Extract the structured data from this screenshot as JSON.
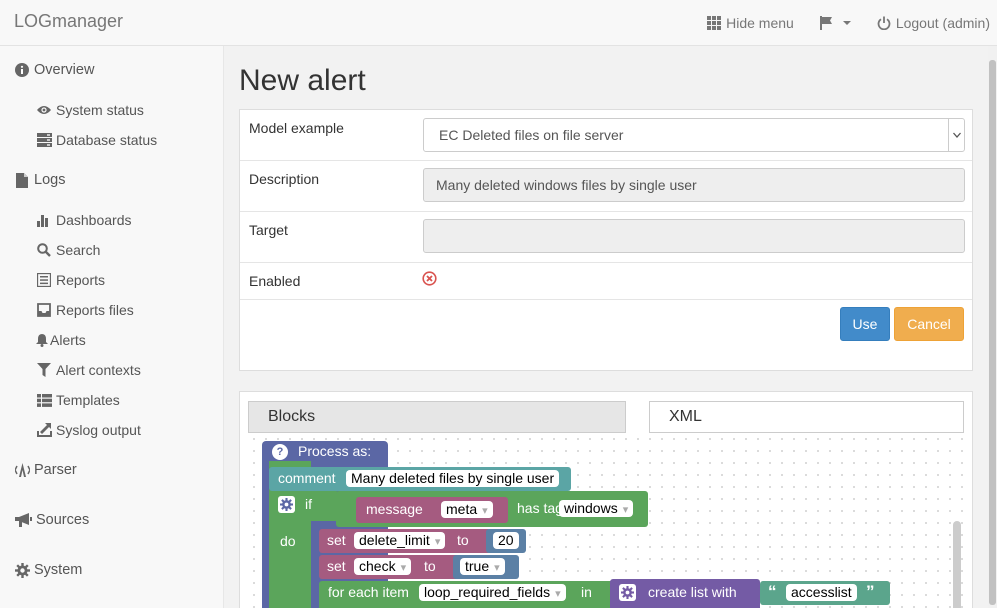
{
  "app": {
    "brand": "LOGmanager"
  },
  "navbar": {
    "hide_menu": "Hide menu",
    "logout": "Logout (admin)",
    "icons": [
      "grid-icon",
      "flag-icon",
      "power-icon"
    ]
  },
  "sidebar": {
    "overview": "Overview",
    "system_status": "System status",
    "database_status": "Database status",
    "logs": "Logs",
    "dashboards": "Dashboards",
    "search": "Search",
    "reports": "Reports",
    "reports_files": "Reports files",
    "alerts": "Alerts",
    "alert_contexts": "Alert contexts",
    "templates": "Templates",
    "syslog_output": "Syslog output",
    "parser": "Parser",
    "sources": "Sources",
    "system": "System"
  },
  "page": {
    "title": "New alert"
  },
  "form": {
    "model_label": "Model example",
    "model_value": "EC Deleted files on file server",
    "description_label": "Description",
    "description_value": "Many deleted windows files by single user",
    "target_label": "Target",
    "target_value": "",
    "enabled_label": "Enabled",
    "enabled": false,
    "use_button": "Use",
    "cancel_button": "Cancel"
  },
  "editor": {
    "tab_blocks": "Blocks",
    "tab_xml": "XML",
    "blocks": {
      "process_as": "Process as:",
      "comment": "comment",
      "comment_text": "Many deleted files by single user",
      "if": "if",
      "message": "message",
      "meta": "meta",
      "has_tag": "has tag",
      "tag_value": "windows",
      "do": "do",
      "set1": "set",
      "var1": "delete_limit",
      "to1": "to",
      "val1": "20",
      "set2": "set",
      "var2": "check",
      "to2": "to",
      "val2": "true",
      "for_each": "for each item",
      "loop_var": "loop_required_fields",
      "in": "in",
      "create_list": "create list with",
      "quote_open": "“",
      "list_item": "accesslist",
      "quote_close": "”"
    }
  },
  "colors": {
    "primary": "#428bca",
    "warning": "#f0ad4e",
    "danger": "#d9534f",
    "procedure_block": "#5b67a5",
    "comment_block": "#5ba5a5",
    "logic_block": "#5ba55b",
    "variable_block": "#a55b80",
    "list_block": "#745ba5",
    "math_block": "#5b80a5",
    "text_block": "#5ba58c"
  }
}
